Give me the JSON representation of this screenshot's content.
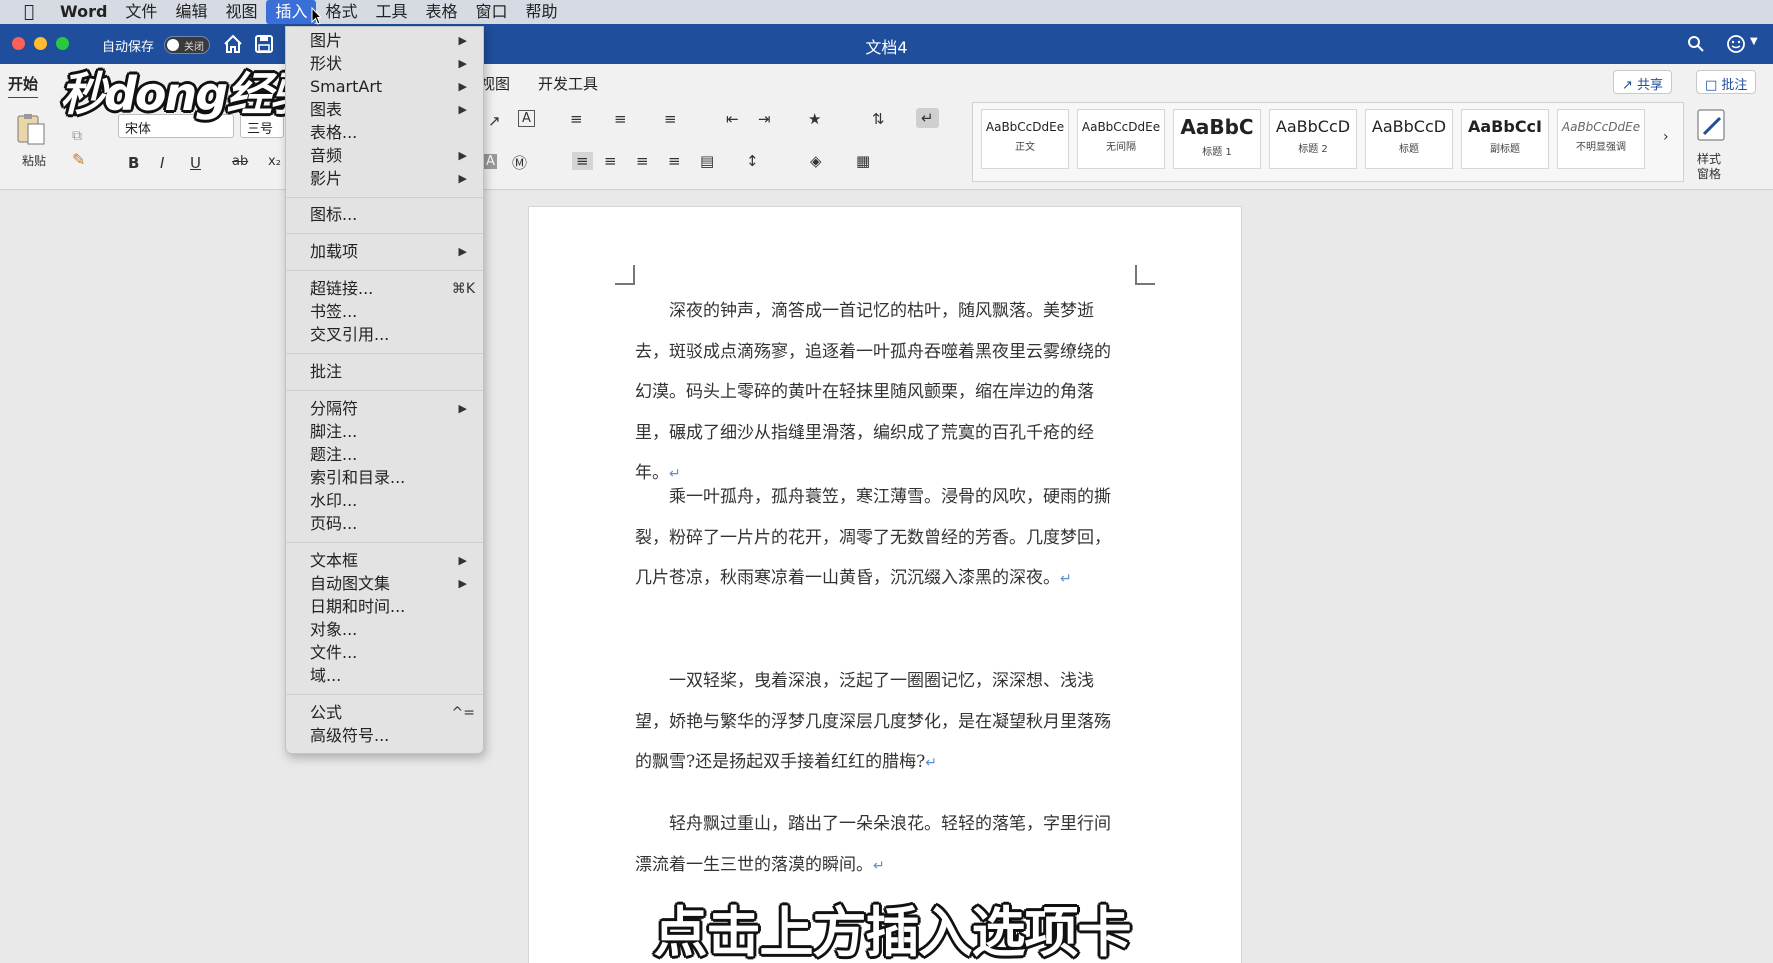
{
  "menubar": {
    "items": [
      "Word",
      "文件",
      "编辑",
      "视图",
      "插入",
      "格式",
      "工具",
      "表格",
      "窗口",
      "帮助"
    ]
  },
  "titlebar": {
    "autosave_label": "自动保存",
    "autosave_state": "关闭",
    "document_title": "文档4"
  },
  "ribbon": {
    "tab_home": "开始",
    "tab_view": "视图",
    "tab_developer": "开发工具",
    "share_label": "共享",
    "comments_label": "批注",
    "paste_label": "粘贴",
    "font_name": "宋体",
    "font_size": "三号",
    "styles_pane_label_1": "样式",
    "styles_pane_label_2": "窗格",
    "styles": [
      {
        "sample": "AaBbCcDdEe",
        "name": "正文"
      },
      {
        "sample": "AaBbCcDdEe",
        "name": "无间隔"
      },
      {
        "sample": "AaBbC",
        "name": "标题 1"
      },
      {
        "sample": "AaBbCcD",
        "name": "标题 2"
      },
      {
        "sample": "AaBbCcD",
        "name": "标题"
      },
      {
        "sample": "AaBbCcI",
        "name": "副标题"
      },
      {
        "sample": "AaBbCcDdEe",
        "name": "不明显强调"
      }
    ]
  },
  "watermark": "秒dong经验",
  "insert_menu": {
    "items": [
      "图片",
      "形状",
      "SmartArt",
      "图表",
      "表格...",
      "音频",
      "影片",
      "图标...",
      "加载项",
      "超链接...",
      "书签...",
      "交叉引用...",
      "批注",
      "分隔符",
      "脚注...",
      "题注...",
      "索引和目录...",
      "水印...",
      "页码...",
      "文本框",
      "自动图文集",
      "日期和时间...",
      "对象...",
      "文件...",
      "域...",
      "公式",
      "高级符号..."
    ],
    "shortcut_hyperlink": "⌘K",
    "shortcut_equation": "^="
  },
  "document": {
    "paragraphs": [
      "深夜的钟声，滴答成一首记忆的枯叶，随风飘落。美梦逝去，斑驳成点滴殇寥，追逐着一叶孤舟吞噬着黑夜里云雾缭绕的幻漠。码头上零碎的黄叶在轻抹里随风颤栗，缩在岸边的角落里，碾成了细沙从指缝里滑落，编织成了荒寞的百孔千疮的经年。",
      "乘一叶孤舟，孤舟蓑笠，寒江薄雪。浸骨的风吹，硬雨的撕裂，粉碎了一片片的花开，凋零了无数曾经的芳香。几度梦回，几片苍凉，秋雨寒凉着一山黄昏，沉沉缀入漆黑的深夜。",
      "一双轻桨，曳着深浪，泛起了一圈圈记忆，深深想、浅浅望，娇艳与繁华的浮梦几度深层几度梦化，是在凝望秋月里落殇的飘雪?还是扬起双手接着红红的腊梅?",
      "轻舟飘过重山，踏出了一朵朵浪花。轻轻的落笔，字里行间漂流着一生三世的落漠的瞬间。"
    ],
    "paragraph_mark": "↵"
  },
  "subtitle": "点击上方插入选项卡"
}
